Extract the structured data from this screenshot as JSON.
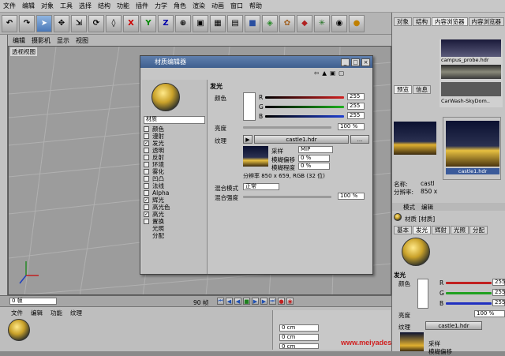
{
  "menu": [
    "文件",
    "编辑",
    "对象",
    "工具",
    "选择",
    "结构",
    "功能",
    "插件",
    "力学",
    "角色",
    "渲染",
    "动画",
    "窗口",
    "帮助"
  ],
  "toolbar": {
    "x": "X",
    "y": "Y",
    "z": "Z"
  },
  "viewport": {
    "menu": [
      "编辑",
      "摄影机",
      "显示",
      "视图"
    ],
    "label": "透视视图"
  },
  "timeline": {
    "frame_start": "0 帧",
    "frame_end": "90 帧"
  },
  "bottom": {
    "menu": [
      "文件",
      "编辑",
      "功能",
      "纹理"
    ],
    "coords": [
      "0 cm",
      "0 cm",
      "0 cm"
    ],
    "watermark": "www.meiyadesign.com"
  },
  "dialog": {
    "title": "材质编辑器",
    "material_name": "材质",
    "channels": [
      {
        "label": "颜色",
        "checked": false
      },
      {
        "label": "漫射",
        "checked": false
      },
      {
        "label": "发光",
        "checked": true
      },
      {
        "label": "透明",
        "checked": false
      },
      {
        "label": "反射",
        "checked": false
      },
      {
        "label": "环境",
        "checked": false
      },
      {
        "label": "雾化",
        "checked": false
      },
      {
        "label": "凹凸",
        "checked": false
      },
      {
        "label": "法线",
        "checked": false
      },
      {
        "label": "Alpha",
        "checked": false
      },
      {
        "label": "辉光",
        "checked": true
      },
      {
        "label": "高光色",
        "checked": false
      },
      {
        "label": "高光",
        "checked": true
      },
      {
        "label": "置换",
        "checked": false
      },
      {
        "label": "光照",
        "checked": null
      },
      {
        "label": "分配",
        "checked": null
      }
    ],
    "section": "发光",
    "color_label": "颜色",
    "r": "255",
    "g": "255",
    "b": "255",
    "brightness_label": "亮度",
    "brightness": "100 %",
    "texture_label": "纹理",
    "texture_file": "castle1.hdr",
    "texture_more": "...",
    "sampling_label": "采样",
    "sampling": "MIP",
    "blur_offset_label": "模糊偏移",
    "blur_offset": "0 %",
    "blur_scale_label": "模糊程度",
    "blur_scale": "0 %",
    "resolution": "分辨率 850 x 659, RGB (32 位)",
    "mix_mode_label": "混合模式",
    "mix_mode": "正常",
    "mix_strength_label": "混合强度",
    "mix_strength": "100 %",
    "letters": {
      "r": "R",
      "g": "G",
      "b": "B"
    }
  },
  "right": {
    "tabs": [
      "对象",
      "结构",
      "内容浏览器",
      "内容浏览器"
    ],
    "file1": "campus_probe.hdr",
    "file2": "CarWash-SkyDom..",
    "preview_tabs": [
      "预览",
      "信息"
    ],
    "name_label": "名称:",
    "name_val": "castl",
    "res_label": "分辨率:",
    "res_val": "850 x",
    "thumb_caption": "castle1.hdr",
    "attr_menu": [
      "模式",
      "编辑"
    ],
    "attr_title": "材质 [材质]",
    "attr_tabs": [
      "基本",
      "发光",
      "辉射",
      "光照",
      "分配"
    ],
    "attr_section": "发光",
    "color_label": "颜色",
    "r": "255",
    "g": "255",
    "b": "255",
    "brightness_label": "亮度",
    "brightness": "100 %",
    "texture_label": "纹理",
    "texture": "castle1.hdr",
    "sampling_label": "采样",
    "blur_offset_label": "模糊偏移",
    "letters": {
      "r": "R",
      "g": "G",
      "b": "B"
    }
  }
}
